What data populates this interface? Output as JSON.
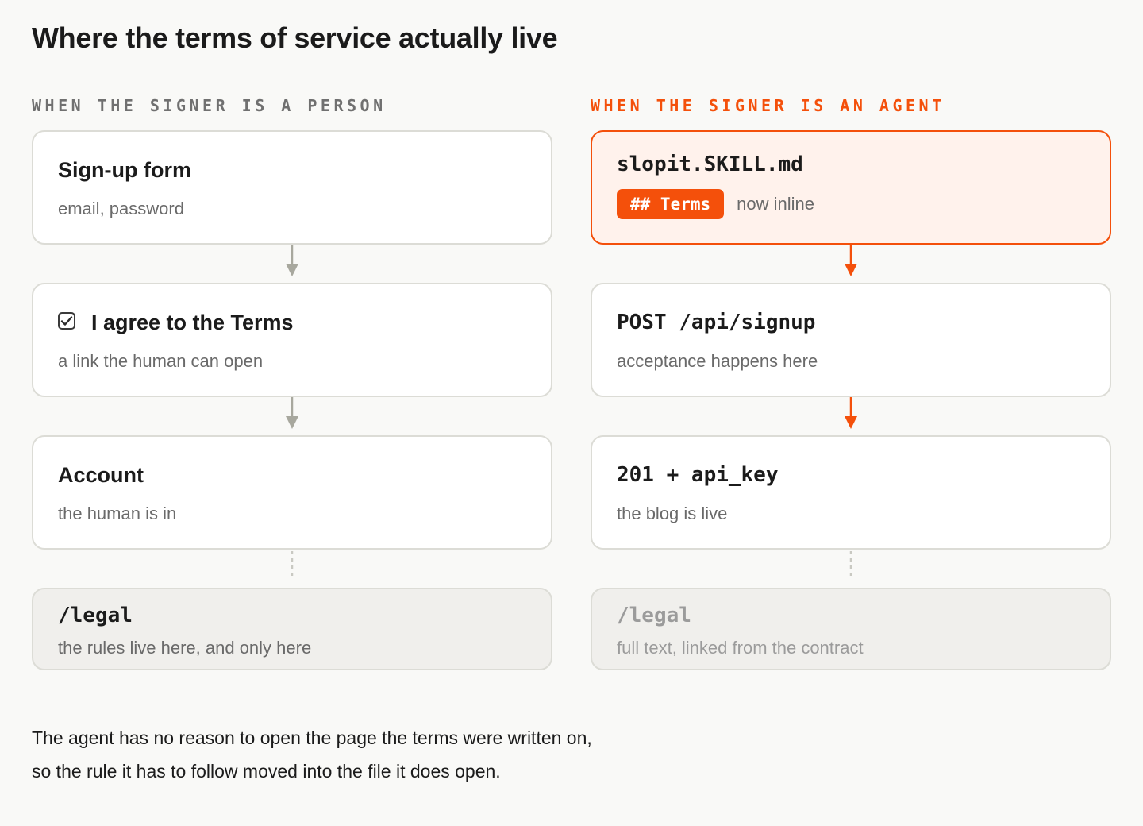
{
  "title": "Where the terms of service actually live",
  "colors": {
    "accent": "#f4500b",
    "neutral_arrow": "#a8a89e",
    "box_border": "#dcdcd6"
  },
  "person": {
    "label": "WHEN THE SIGNER IS A PERSON",
    "steps": [
      {
        "title": "Sign-up form",
        "sub": "email, password"
      },
      {
        "title": "I agree to the Terms",
        "sub": "a link the human can open",
        "icon": "checkbox-checked-icon"
      },
      {
        "title": "Account",
        "sub": "the human is in"
      }
    ],
    "legal": {
      "title": "/legal",
      "sub": "the rules live here, and only here"
    }
  },
  "agent": {
    "label": "WHEN THE SIGNER IS AN AGENT",
    "steps": [
      {
        "title": "slopit.SKILL.md",
        "badge": "## Terms",
        "note": "now inline"
      },
      {
        "title": "POST /api/signup",
        "sub": "acceptance happens here"
      },
      {
        "title": "201 + api_key",
        "sub": "the blog is live"
      }
    ],
    "legal": {
      "title": "/legal",
      "sub": "full text, linked from the contract"
    }
  },
  "footer": {
    "line1": "The agent has no reason to open the page the terms were written on,",
    "line2": "so the rule it has to follow moved into the file it does open."
  }
}
